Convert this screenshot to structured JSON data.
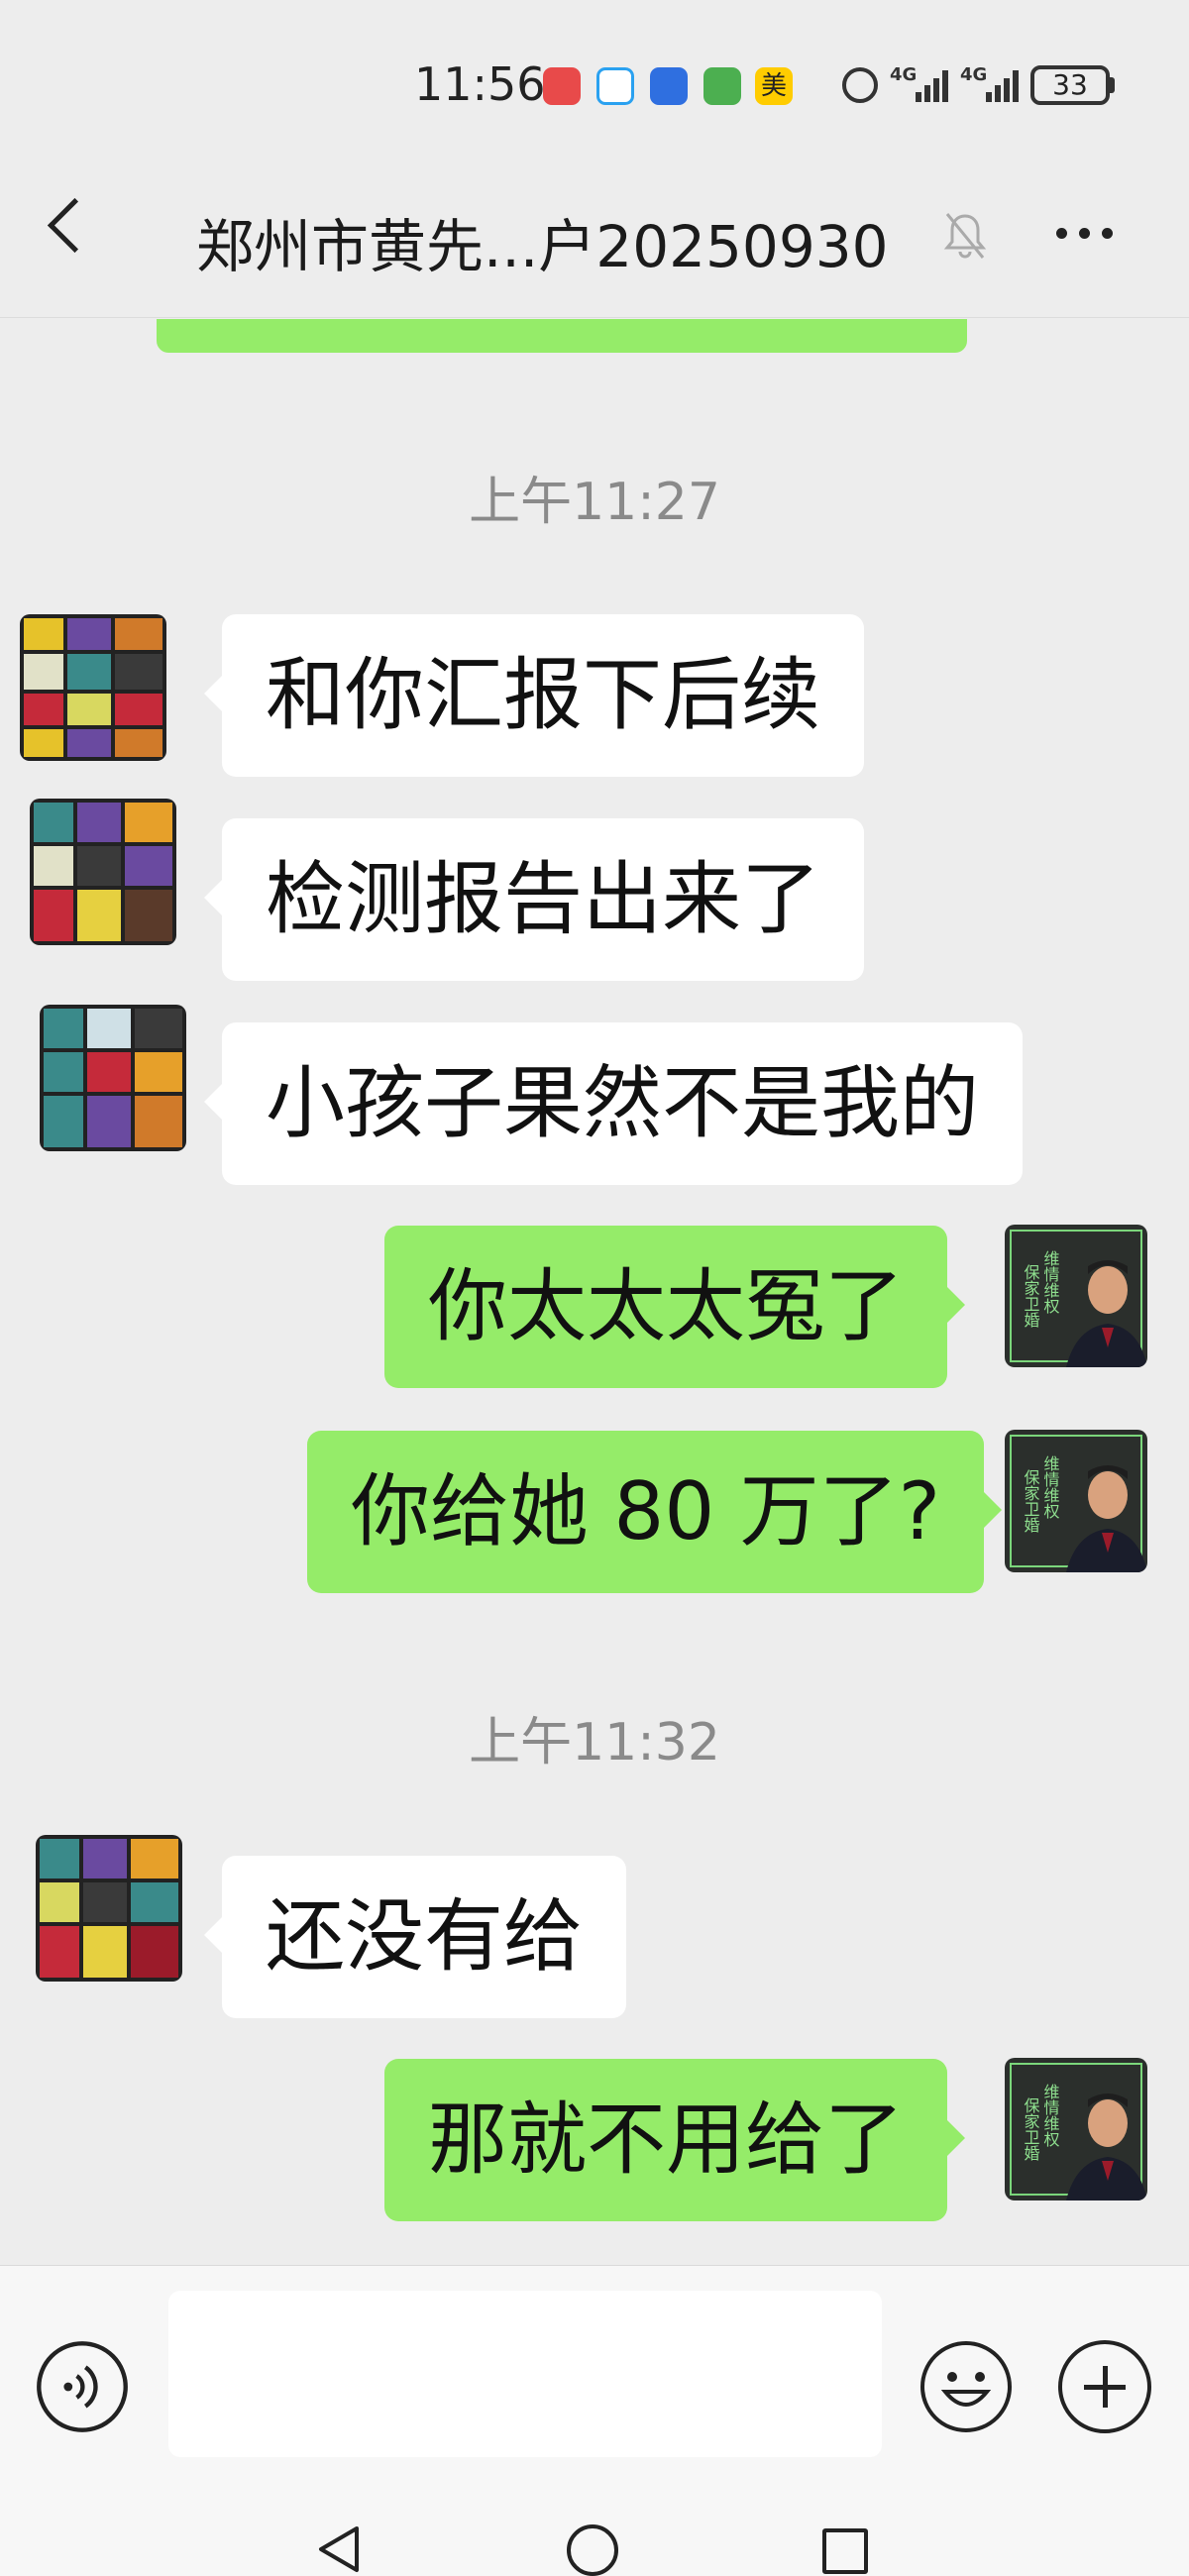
{
  "status_bar": {
    "time": "11:56",
    "network_1": "4G",
    "network_2": "4G",
    "battery": "33"
  },
  "header": {
    "title": "郑州市黄先...户20250930",
    "icons": [
      "back-icon",
      "mute-bell-icon",
      "more-icon"
    ]
  },
  "messages": [
    {
      "type": "time",
      "text": "上午11:27"
    },
    {
      "type": "received",
      "text": "和你汇报下后续"
    },
    {
      "type": "received",
      "text": "检测报告出来了"
    },
    {
      "type": "received",
      "text": "小孩子果然不是我的"
    },
    {
      "type": "sent",
      "text": "你太太太冤了"
    },
    {
      "type": "sent",
      "text": "你给她 80 万了?"
    },
    {
      "type": "time",
      "text": "上午11:32"
    },
    {
      "type": "received",
      "text": "还没有给"
    },
    {
      "type": "sent",
      "text": "那就不用给了"
    }
  ],
  "avatar_sent": {
    "badge_lines": [
      "维情维权",
      "保家卫婚"
    ]
  },
  "input_bar": {
    "message_value": "",
    "icons": [
      "voice-icon",
      "emoji-icon",
      "plus-icon"
    ]
  },
  "nav_bar": {
    "icons": [
      "nav-back-icon",
      "nav-home-icon",
      "nav-recents-icon"
    ]
  },
  "colors": {
    "background": "#ededed",
    "sent_bubble": "#95ec69",
    "received_bubble": "#ffffff",
    "timestamp": "#8a8a8a"
  }
}
